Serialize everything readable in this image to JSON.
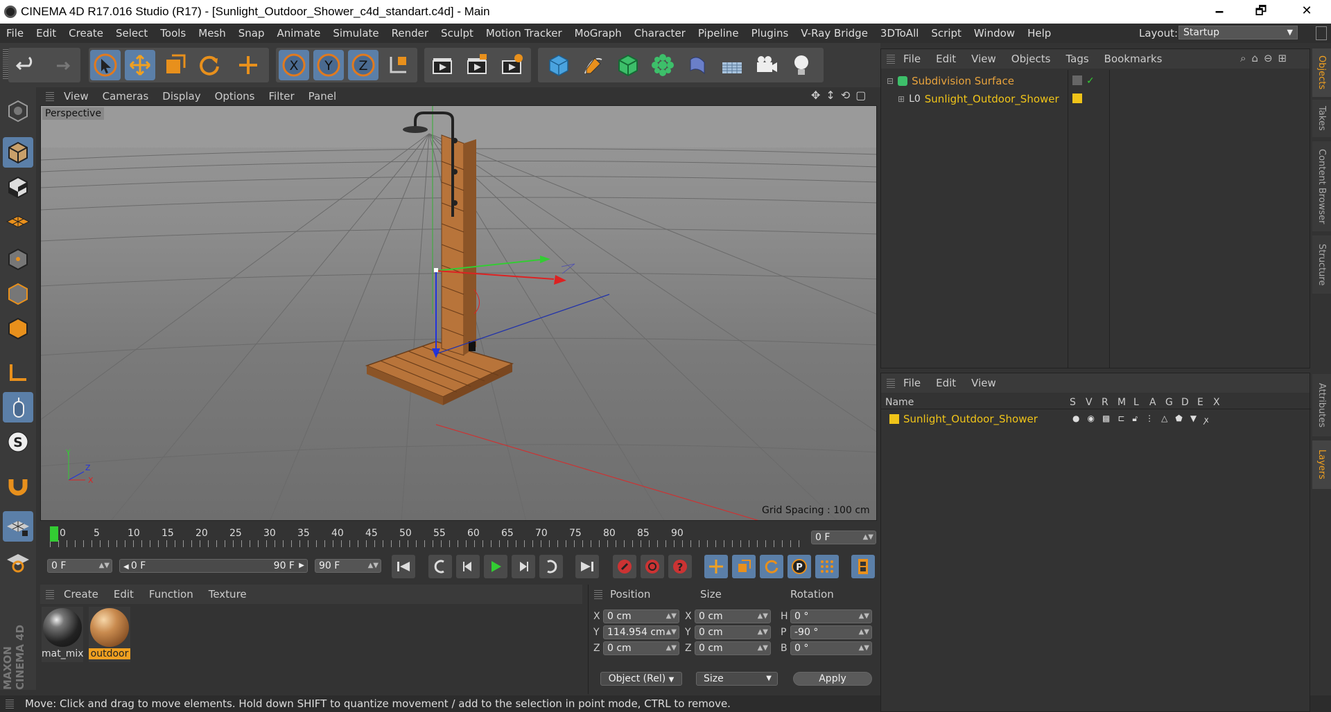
{
  "window": {
    "title": "CINEMA 4D R17.016 Studio (R17) - [Sunlight_Outdoor_Shower_c4d_standart.c4d] - Main",
    "minimize": "🗕",
    "maximize": "🗗",
    "close": "✕"
  },
  "menu": [
    "File",
    "Edit",
    "Create",
    "Select",
    "Tools",
    "Mesh",
    "Snap",
    "Animate",
    "Simulate",
    "Render",
    "Sculpt",
    "Motion Tracker",
    "MoGraph",
    "Character",
    "Pipeline",
    "Plugins",
    "V-Ray Bridge",
    "3DToAll",
    "Script",
    "Window",
    "Help"
  ],
  "layout": {
    "label": "Layout:",
    "value": "Startup"
  },
  "viewport": {
    "menu": [
      "View",
      "Cameras",
      "Display",
      "Options",
      "Filter",
      "Panel"
    ],
    "camera_label": "Perspective",
    "grid_spacing": "Grid Spacing : 100 cm",
    "axis_y": "Y",
    "axis_z": "Z",
    "axis_x": "X"
  },
  "objects_panel": {
    "menu": [
      "File",
      "Edit",
      "View",
      "Objects",
      "Tags",
      "Bookmarks"
    ],
    "items": [
      {
        "name": "Subdivision Surface",
        "color": "#e8a33d"
      },
      {
        "name": "Sunlight_Outdoor_Shower",
        "color": "#f0c419"
      }
    ]
  },
  "layers_panel": {
    "menu": [
      "File",
      "Edit",
      "View"
    ],
    "columns": [
      "Name",
      "S",
      "V",
      "R",
      "M",
      "L",
      "A",
      "G",
      "D",
      "E",
      "X"
    ],
    "rows": [
      {
        "name": "Sunlight_Outdoor_Shower",
        "color": "#f0c419"
      }
    ]
  },
  "right_tabs": [
    "Objects",
    "Takes",
    "Content Browser",
    "Structure",
    "Attributes",
    "Layers"
  ],
  "timeline": {
    "ticks": [
      "0",
      "5",
      "10",
      "15",
      "20",
      "25",
      "30",
      "35",
      "40",
      "45",
      "50",
      "55",
      "60",
      "65",
      "70",
      "75",
      "80",
      "85",
      "90"
    ],
    "current_frame": "0 F",
    "start": "0 F",
    "range_start": "0 F",
    "range_end": "90 F",
    "end": "90 F"
  },
  "materials": {
    "menu": [
      "Create",
      "Edit",
      "Function",
      "Texture"
    ],
    "items": [
      {
        "name": "mat_mix"
      },
      {
        "name": "outdoor"
      }
    ]
  },
  "coords": {
    "headers": [
      "Position",
      "Size",
      "Rotation"
    ],
    "rows": [
      {
        "axis": "X",
        "pos": "0 cm",
        "saxis": "X",
        "size": "0 cm",
        "raxis": "H",
        "rot": "0 °"
      },
      {
        "axis": "Y",
        "pos": "114.954 cm",
        "saxis": "Y",
        "size": "0 cm",
        "raxis": "P",
        "rot": "-90 °"
      },
      {
        "axis": "Z",
        "pos": "0 cm",
        "saxis": "Z",
        "size": "0 cm",
        "raxis": "B",
        "rot": "0 °"
      }
    ],
    "mode": "Object (Rel)",
    "size_mode": "Size",
    "apply": "Apply"
  },
  "brand": "MAXON CINEMA 4D",
  "status": "Move: Click and drag to move elements. Hold down SHIFT to quantize movement / add to the selection in point mode, CTRL to remove."
}
